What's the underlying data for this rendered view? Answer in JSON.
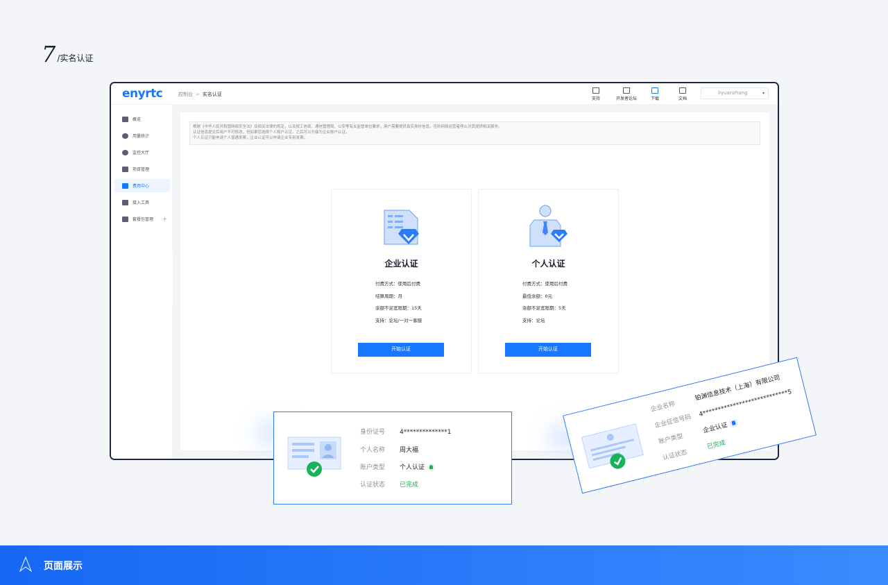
{
  "section": {
    "number": "7",
    "title": "/实名认证"
  },
  "app": {
    "logo": "enyrtc",
    "breadcrumb": {
      "root": "控制台",
      "sep": ">",
      "current": "实名认证"
    },
    "toolbar": [
      {
        "label": "支持",
        "icon": "support-icon"
      },
      {
        "label": "开发者论坛",
        "icon": "forum-icon"
      },
      {
        "label": "下载",
        "icon": "download-icon"
      },
      {
        "label": "文档",
        "icon": "document-icon"
      }
    ],
    "user": {
      "name": "liyuanzhang"
    },
    "sidebar": [
      {
        "label": "概览",
        "icon": "home-icon"
      },
      {
        "label": "用量统计",
        "icon": "pie-chart-icon"
      },
      {
        "label": "监控大厅",
        "icon": "monitor-icon"
      },
      {
        "label": "项目管理",
        "icon": "folder-icon"
      },
      {
        "label": "费用中心",
        "icon": "wallet-icon",
        "active": true
      },
      {
        "label": "接入工具",
        "icon": "tool-icon"
      },
      {
        "label": "套餐包管理",
        "icon": "package-icon",
        "expand": "+"
      }
    ],
    "notice": [
      "根据《中华人民共和国网络安全法》及相关法律的规定，以及按工信部、通信管理局、公安等有关监管单位要求，用户需要提供真实身份信息，否则网络运营者停止对其提供相关服务。",
      "认证信息提交后用户不可修改，但如果您选择个人账户认证，之后可以升级为企业账户认证。",
      "个人认证只能申请个人普通发票，企业认证可以申请企业专用发票。"
    ],
    "cards": [
      {
        "title": "企业认证",
        "lines": [
          "付费方式：使用后付费",
          "结算周期：月",
          "余额不足宽限期：15天",
          "支持：论坛/一对一客服"
        ],
        "button": "开始认证",
        "icon": "enterprise-cert-icon"
      },
      {
        "title": "个人认证",
        "lines": [
          "付费方式：使用后付费",
          "最低余额：0元",
          "余额不足宽限期：5天",
          "支持：论坛"
        ],
        "button": "开始认证",
        "icon": "personal-cert-icon"
      }
    ]
  },
  "personal_result": {
    "rows": [
      {
        "label": "身份证号",
        "value": "4**************1"
      },
      {
        "label": "个人名称",
        "value": "周大福"
      },
      {
        "label": "账户类型",
        "value": "个人认证"
      },
      {
        "label": "认证状态",
        "value": "已完成"
      }
    ]
  },
  "enterprise_result": {
    "rows": [
      {
        "label": "企业名称",
        "value": "铂渊信息技术（上海）有限公司"
      },
      {
        "label": "企业征信号码",
        "value": "4****************************5"
      },
      {
        "label": "账户类型",
        "value": "企业认证"
      },
      {
        "label": "认证状态",
        "value": "已完成"
      }
    ]
  },
  "footer": {
    "title": "页面展示"
  },
  "colors": {
    "primary": "#1677ff",
    "success": "#19b25a",
    "frame": "#1d2540"
  }
}
